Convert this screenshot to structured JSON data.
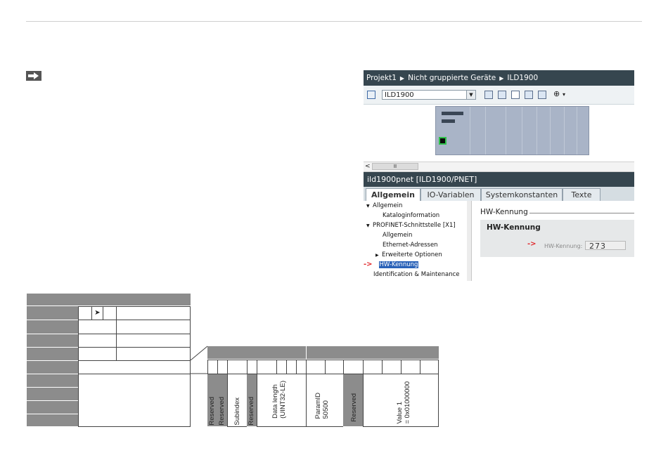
{
  "tia": {
    "breadcrumb": [
      "Projekt1",
      "Nicht gruppierte Geräte",
      "ILD1900"
    ],
    "device_select": "ILD1900",
    "scroll_label": "II",
    "panel_title": "ild1900pnet [ILD1900/PNET]",
    "tabs": [
      "Allgemein",
      "IO-Variablen",
      "Systemkonstanten",
      "Texte"
    ],
    "tree": [
      {
        "label": "Allgemein",
        "level": 0,
        "expanded": true
      },
      {
        "label": "Kataloginformation",
        "level": 2
      },
      {
        "label": "PROFINET-Schnittstelle [X1]",
        "level": 0,
        "expanded": true
      },
      {
        "label": "Allgemein",
        "level": 2
      },
      {
        "label": "Ethernet-Adressen",
        "level": 2
      },
      {
        "label": "Erweiterte Optionen",
        "level": 1,
        "collapsed": true
      },
      {
        "label": "HW-Kennung",
        "level": 2,
        "selected": true
      },
      {
        "label": "Identification & Maintenance",
        "level": 0
      }
    ],
    "section_header": "HW-Kennung",
    "group_title": "HW-Kennung",
    "field_label": "HW-Kennung:",
    "field_value": "273",
    "marker": "->"
  },
  "bit_table": {
    "labels": [
      {
        "text": "Reserved"
      },
      {
        "text": "Reserved"
      },
      {
        "text": "Subindex"
      },
      {
        "text": "Reserved"
      },
      {
        "text": "Data length\n(UINT32-LE)"
      },
      {
        "text": "ParamID\n50500"
      },
      {
        "text": "Reserved"
      },
      {
        "text": "Value 1\n= 0x01000000"
      }
    ]
  },
  "colors": {
    "tia_header": "#36464f",
    "gray": "#8c8c8c",
    "selection": "#2a62b8",
    "red_marker": "#e0262a"
  }
}
